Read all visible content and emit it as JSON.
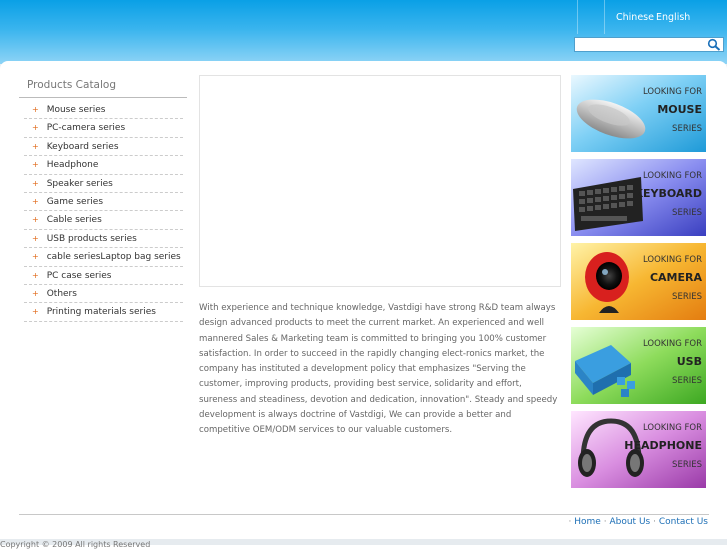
{
  "header": {
    "languages": [
      "Chinese",
      "English"
    ],
    "search": {
      "value": "",
      "placeholder": ""
    }
  },
  "sidebar": {
    "title": "Products Catalog",
    "items": [
      "Mouse series",
      "PC-camera series",
      "Keyboard series",
      "Headphone",
      "Speaker series",
      "Game series",
      "Cable series",
      "USB products series",
      "cable seriesLaptop bag series",
      "PC case series",
      "Others",
      "Printing materials series"
    ]
  },
  "main": {
    "about": "With experience and technique knowledge, Vastdigi have strong R&D team always design advanced products to meet the current market. An experienced and well mannered Sales & Marketing team is committed to bringing you 100% customer satisfaction. In order to succeed in the rapidly changing elect-ronics market, the company has instituted a development policy that emphasizes \"Serving the customer, improving products, providing best service, solidarity and effort, sureness and steadiness, devotion and dedication, innovation\". Steady and speedy development is always doctrine of Vastdigi, We can provide a better and competitive OEM/ODM services to our valuable customers."
  },
  "promos": [
    {
      "looking": "LOOKING FOR",
      "name": "MOUSE",
      "series": "SERIES",
      "color": "#2fa6e0"
    },
    {
      "looking": "LOOKING FOR",
      "name": "KEYBOARD",
      "series": "SERIES",
      "color": "#5a5fd0"
    },
    {
      "looking": "LOOKING FOR",
      "name": "CAMERA",
      "series": "SERIES",
      "color": "#f2a21a"
    },
    {
      "looking": "LOOKING FOR",
      "name": "USB",
      "series": "SERIES",
      "color": "#5fc23c"
    },
    {
      "looking": "LOOKING FOR",
      "name": "HEADPHONE",
      "series": "SERIES",
      "color": "#c05ac8"
    }
  ],
  "footer": {
    "links": [
      "Home",
      "About Us",
      "Contact Us"
    ],
    "separator": "·",
    "copyright": "Copyright © 2009 All rights Reserved"
  }
}
